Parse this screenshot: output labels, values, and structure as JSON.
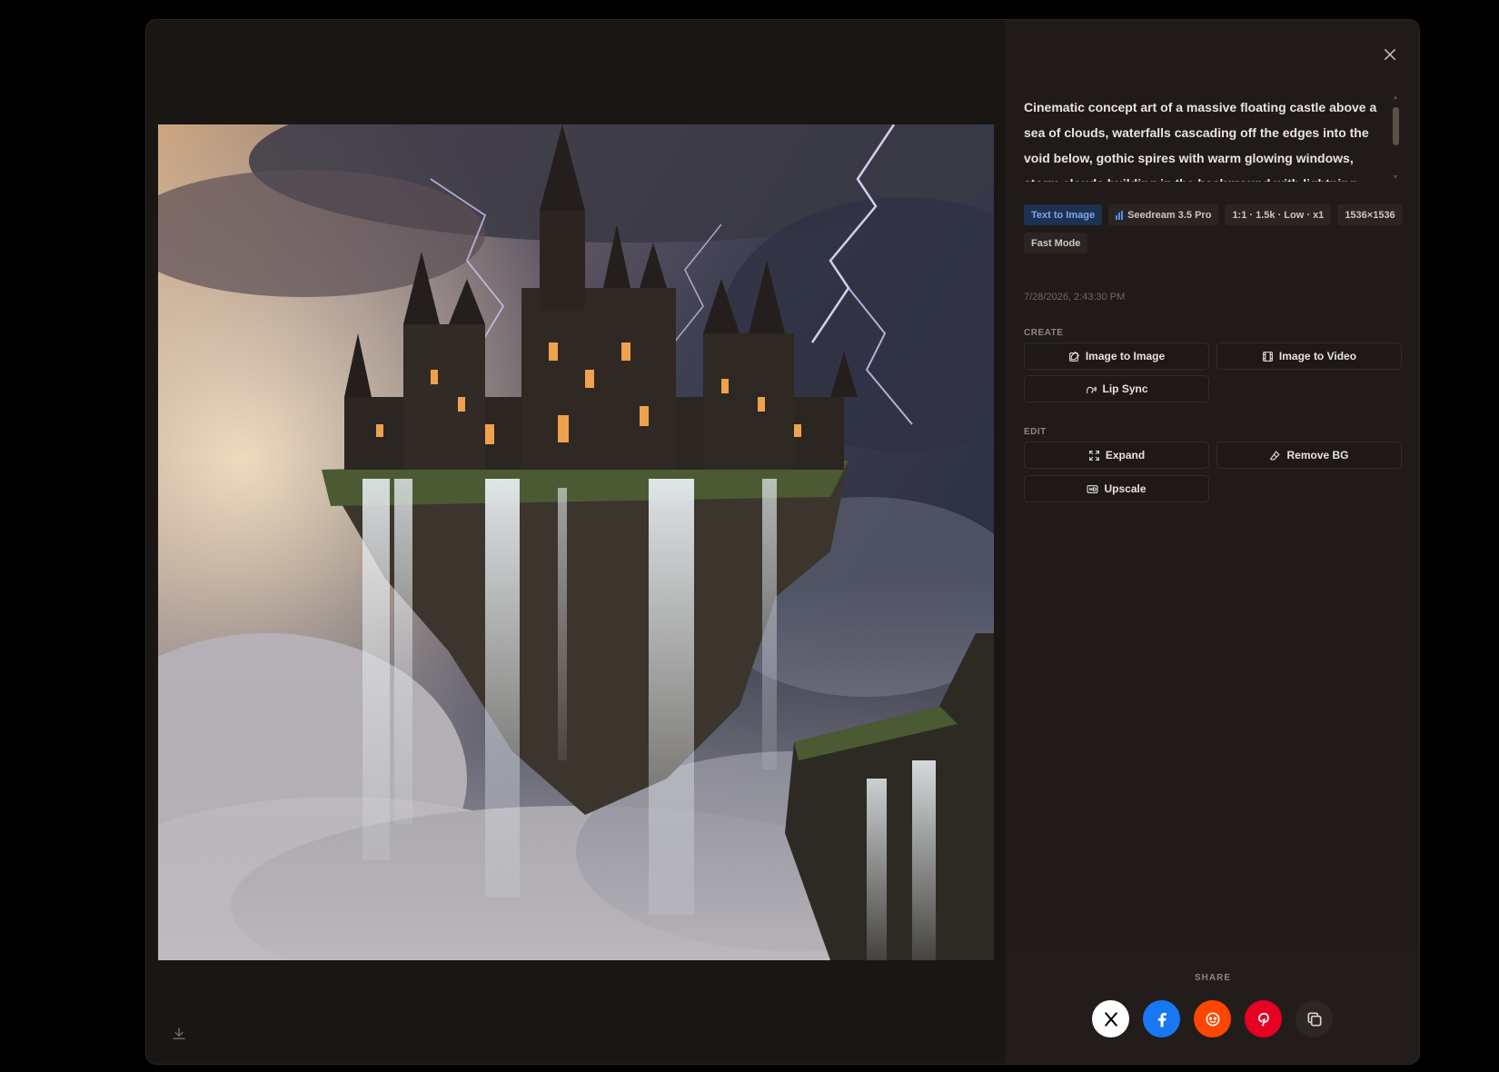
{
  "prompt": "Cinematic concept art of a massive floating castle above a sea of clouds, waterfalls cascading off the edges into the void below, gothic spires with warm glowing windows, storm clouds building in the background with lightning",
  "tags": {
    "mode": "Text to Image",
    "model": "Seedream 3.5 Pro",
    "settings": "1:1 · 1.5k · Low · x1",
    "size": "1536×1536",
    "speed": "Fast Mode"
  },
  "timestamp": "7/28/2026, 2:43:30 PM",
  "create": {
    "label": "CREATE",
    "image_to_image": "Image to Image",
    "image_to_video": "Image to Video",
    "lip_sync": "Lip Sync"
  },
  "edit": {
    "label": "EDIT",
    "expand": "Expand",
    "remove_bg": "Remove BG",
    "upscale": "Upscale"
  },
  "share": {
    "label": "SHARE",
    "icons": [
      "x-icon",
      "facebook-icon",
      "reddit-icon",
      "pinterest-icon",
      "copy-link-icon"
    ]
  },
  "colors": {
    "x": "#ffffff",
    "facebook": "#1877f2",
    "reddit": "#ff4500",
    "pinterest": "#e60023",
    "copy": "#2d2724"
  }
}
